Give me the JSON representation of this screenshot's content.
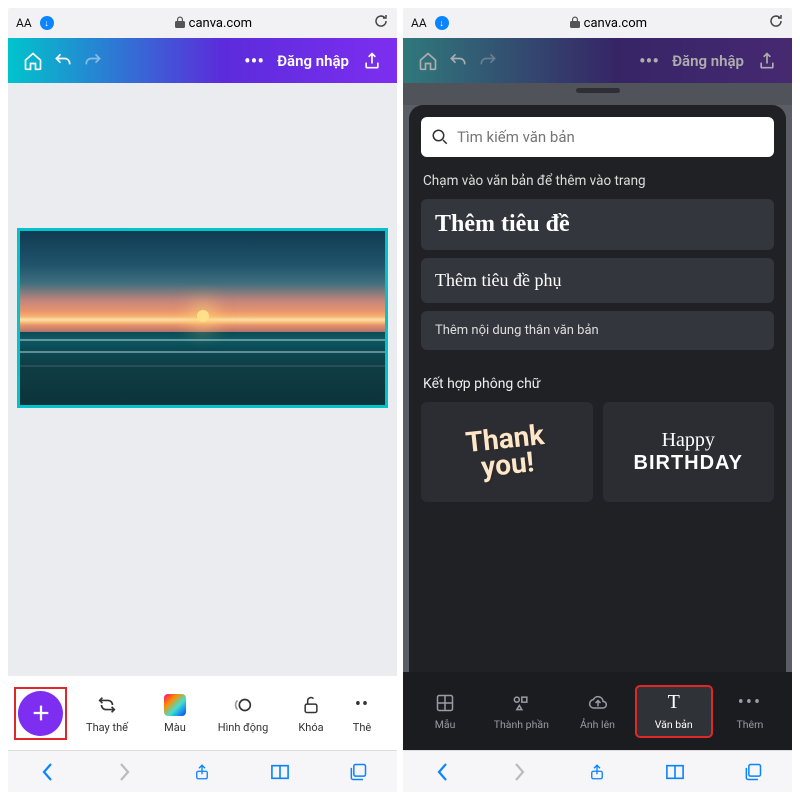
{
  "addr": {
    "aa": "AA",
    "url": "canva.com"
  },
  "topbar": {
    "login": "Đăng nhập"
  },
  "left_tools": {
    "replace": "Thay thế",
    "color": "Màu",
    "anim": "Hình động",
    "lock": "Khóa",
    "more_cut": "Thê"
  },
  "right_sheet": {
    "search_placeholder": "Tìm kiếm văn bản",
    "hint": "Chạm vào văn bản để thêm vào trang",
    "heading": "Thêm tiêu đề",
    "subheading": "Thêm tiêu đề phụ",
    "body": "Thêm nội dung thân văn bản",
    "combo_label": "Kết hợp phông chữ",
    "thank1": "Thank",
    "thank2": "you!",
    "bday1": "Happy",
    "bday2": "BIRTHDAY"
  },
  "right_tools": {
    "template": "Mẫu",
    "elements": "Thành phần",
    "uploads": "Ảnh lên",
    "text": "Văn bản",
    "more": "Thêm"
  }
}
